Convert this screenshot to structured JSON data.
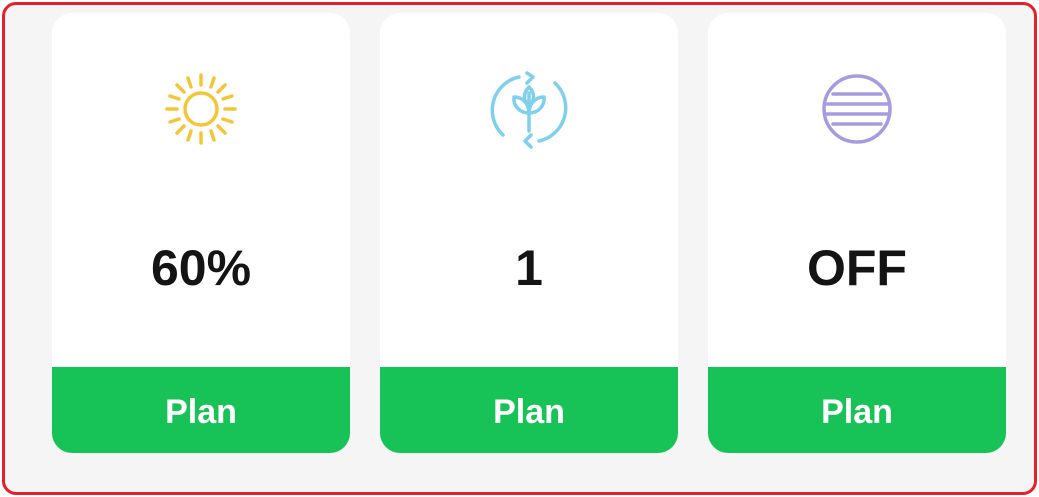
{
  "cards": [
    {
      "icon": "sun-icon",
      "icon_color": "#f5c538",
      "value": "60%",
      "button_label": "Plan"
    },
    {
      "icon": "plant-cycle-icon",
      "icon_color": "#7ed0ec",
      "value": "1",
      "button_label": "Plan"
    },
    {
      "icon": "lines-circle-icon",
      "icon_color": "#a79be0",
      "value": "OFF",
      "button_label": "Plan"
    }
  ],
  "colors": {
    "frame_border": "#e5202b",
    "background": "#f5f5f5",
    "button": "#17c257"
  }
}
